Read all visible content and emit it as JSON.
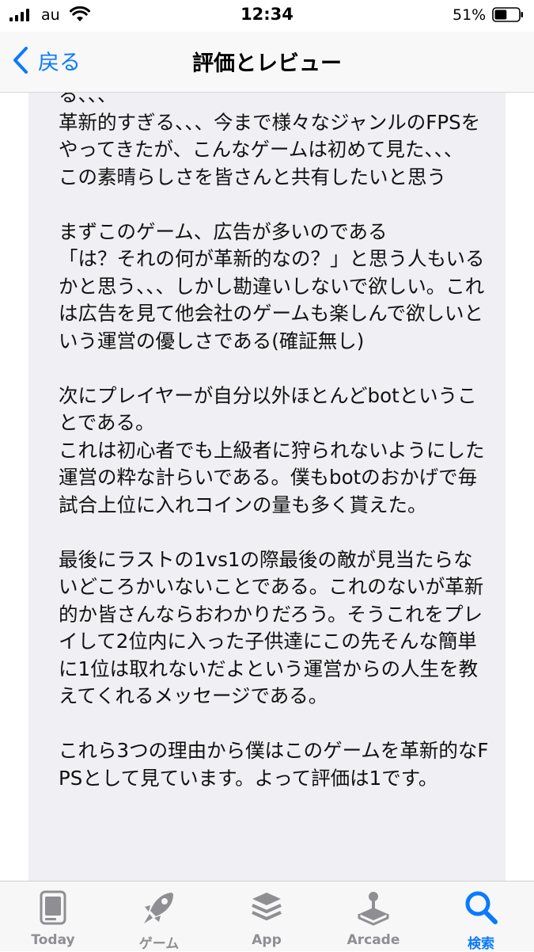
{
  "status_bar": {
    "carrier": "au",
    "time": "12:34",
    "battery_percent": "51%",
    "battery_level": 0.51
  },
  "nav": {
    "back_label": "戻る",
    "title": "評価とレビュー"
  },
  "review": {
    "body": "る、、、\n革新的すぎる、、、今まで様々なジャンルのFPSをやってきたが、こんなゲームは初めて見た、、、\nこの素晴らしさを皆さんと共有したいと思う\n\nまずこのゲーム、広告が多いのである\n「は？それの何が革新的なの？」と思う人もいるかと思う、、、しかし勘違いしないで欲しい。これは広告を見て他会社のゲームも楽しんで欲しいという運営の優しさである(確証無し)\n\n次にプレイヤーが自分以外ほとんどbotということである。\nこれは初心者でも上級者に狩られないようにした運営の粋な計らいである。僕もbotのおかげで毎試合上位に入れコインの量も多く貰えた。\n\n最後にラストの1vs1の際最後の敵が見当たらないどころかいないことである。これのないが革新的か皆さんならおわかりだろう。そうこれをプレイして2位内に入った子供達にこの先そんな簡単に1位は取れないだよという運営からの人生を教えてくれるメッセージである。\n\nこれら3つの理由から僕はこのゲームを革新的なFPSとして見ています。よって評価は1です。"
  },
  "tab_bar": {
    "active_color": "#0a7aff",
    "inactive_color": "#8e8e93",
    "tabs": [
      {
        "label": "Today",
        "icon": "today-icon"
      },
      {
        "label": "ゲーム",
        "icon": "rocket-icon"
      },
      {
        "label": "App",
        "icon": "apps-stack-icon"
      },
      {
        "label": "Arcade",
        "icon": "joystick-icon"
      },
      {
        "label": "検索",
        "icon": "search-icon"
      }
    ]
  }
}
